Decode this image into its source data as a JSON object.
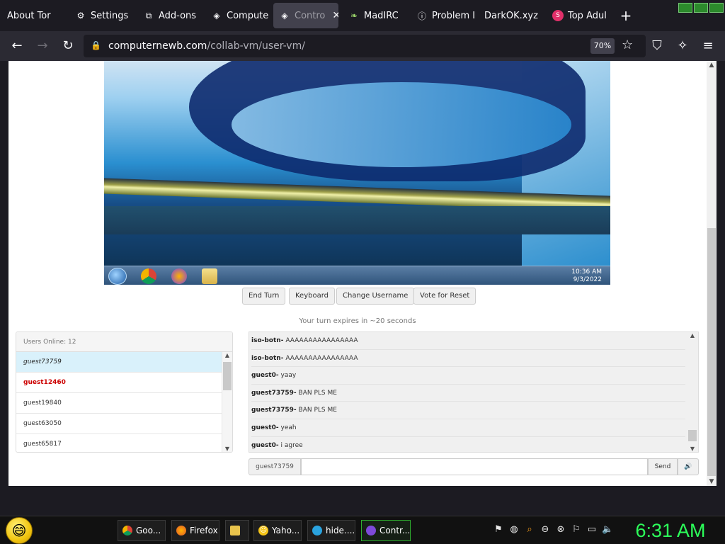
{
  "browser": {
    "tabs": [
      {
        "label": "About Tor",
        "icon": "none"
      },
      {
        "label": "Settings",
        "icon": "gear-icon"
      },
      {
        "label": "Add-ons",
        "icon": "puzzle-icon"
      },
      {
        "label": "Compute",
        "icon": "tor-icon"
      },
      {
        "label": "Contro",
        "icon": "tor-icon",
        "active": true
      },
      {
        "label": "MadIRC",
        "icon": "leaf-icon"
      },
      {
        "label": "Problem L",
        "icon": "info-icon"
      },
      {
        "label": "DarkOK.xyz",
        "icon": "none"
      },
      {
        "label": "Top Adul",
        "icon": "s-icon"
      }
    ],
    "url_domain": "computernewb.com",
    "url_path": "/collab-vm/user-vm/",
    "zoom": "70%"
  },
  "vm": {
    "clock_time": "10:36 AM",
    "clock_date": "9/3/2022"
  },
  "controls": {
    "end_turn": "End Turn",
    "keyboard": "Keyboard",
    "change_username": "Change Username",
    "vote_reset": "Vote for Reset",
    "turn_message": "Your turn expires in ~20 seconds"
  },
  "users": {
    "header": "Users Online: 12",
    "list": [
      "guest73759",
      "guest12460",
      "guest19840",
      "guest63050",
      "guest65817"
    ]
  },
  "chat": {
    "messages": [
      {
        "user": "iso-botn-",
        "text": "AAAAAAAAAAAAAAAA"
      },
      {
        "user": "iso-botn-",
        "text": "AAAAAAAAAAAAAAAA"
      },
      {
        "user": "guest0-",
        "text": "yaay"
      },
      {
        "user": "guest73759-",
        "text": "BAN PLS ME"
      },
      {
        "user": "guest73759-",
        "text": "BAN PLS ME"
      },
      {
        "user": "guest0-",
        "text": "yeah"
      },
      {
        "user": "guest0-",
        "text": "i agree"
      }
    ],
    "username": "guest73759",
    "input_value": "",
    "send_label": "Send",
    "mute_label": "🔊"
  },
  "os": {
    "tasks": [
      {
        "label": "Goo...",
        "icon": "chrome-icon"
      },
      {
        "label": "Firefox",
        "icon": "firefox-icon"
      },
      {
        "label": "",
        "icon": "folder-icon"
      },
      {
        "label": "Yaho...",
        "icon": "yahoo-icon"
      },
      {
        "label": "hide....",
        "icon": "telegram-icon"
      },
      {
        "label": "Contr...",
        "icon": "tor-icon",
        "active": true
      }
    ],
    "clock": "6:31 AM"
  }
}
